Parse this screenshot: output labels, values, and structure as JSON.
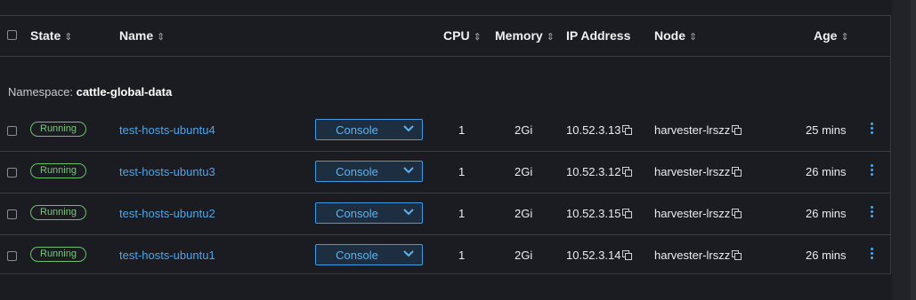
{
  "header": {
    "state": "State",
    "name": "Name",
    "cpu": "CPU",
    "memory": "Memory",
    "ip": "IP Address",
    "node": "Node",
    "age": "Age"
  },
  "namespace": {
    "prefix": "Namespace: ",
    "name": "cattle-global-data"
  },
  "rows": [
    {
      "state": "Running",
      "name": "test-hosts-ubuntu4",
      "console": "Console",
      "cpu": "1",
      "memory": "2Gi",
      "ip": "10.52.3.13",
      "node": "harvester-lrszz",
      "age": "25 mins"
    },
    {
      "state": "Running",
      "name": "test-hosts-ubuntu3",
      "console": "Console",
      "cpu": "1",
      "memory": "2Gi",
      "ip": "10.52.3.12",
      "node": "harvester-lrszz",
      "age": "26 mins"
    },
    {
      "state": "Running",
      "name": "test-hosts-ubuntu2",
      "console": "Console",
      "cpu": "1",
      "memory": "2Gi",
      "ip": "10.52.3.15",
      "node": "harvester-lrszz",
      "age": "26 mins"
    },
    {
      "state": "Running",
      "name": "test-hosts-ubuntu1",
      "console": "Console",
      "cpu": "1",
      "memory": "2Gi",
      "ip": "10.52.3.14",
      "node": "harvester-lrszz",
      "age": "26 mins"
    }
  ],
  "colors": {
    "accent": "#4ea6e6",
    "running": "#78c878",
    "background": "#1b1c21"
  },
  "icons": {
    "sort": "sort-arrows-icon",
    "copy": "copy-icon",
    "more": "kebab-menu-icon",
    "dropdown": "chevron-down-icon"
  }
}
